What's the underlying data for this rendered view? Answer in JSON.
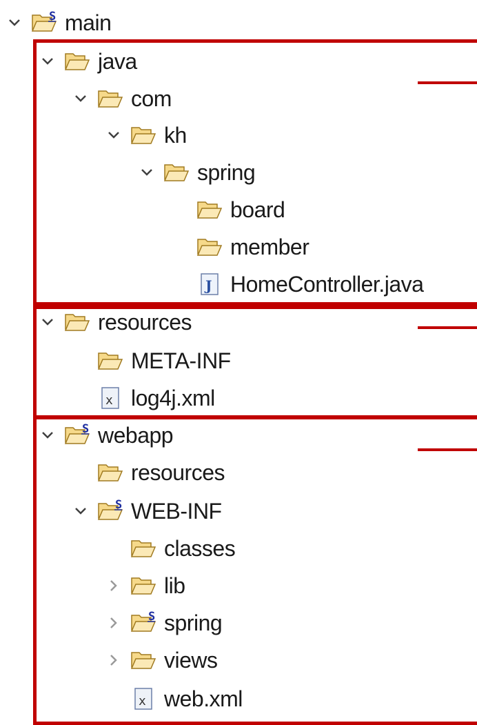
{
  "tree": [
    {
      "label": "main",
      "chevron": "down",
      "icon": "spring-folder"
    },
    {
      "label": "java",
      "chevron": "down",
      "icon": "folder"
    },
    {
      "label": "com",
      "chevron": "down",
      "icon": "folder"
    },
    {
      "label": "kh",
      "chevron": "down",
      "icon": "folder"
    },
    {
      "label": "spring",
      "chevron": "down",
      "icon": "folder"
    },
    {
      "label": "board",
      "chevron": "none",
      "icon": "folder"
    },
    {
      "label": "member",
      "chevron": "none",
      "icon": "folder"
    },
    {
      "label": "HomeController.java",
      "chevron": "none",
      "icon": "java-file"
    },
    {
      "label": "resources",
      "chevron": "down",
      "icon": "folder"
    },
    {
      "label": "META-INF",
      "chevron": "none",
      "icon": "folder"
    },
    {
      "label": "log4j.xml",
      "chevron": "none",
      "icon": "xml-file"
    },
    {
      "label": "webapp",
      "chevron": "down",
      "icon": "spring-folder"
    },
    {
      "label": "resources",
      "chevron": "none",
      "icon": "folder"
    },
    {
      "label": "WEB-INF",
      "chevron": "down",
      "icon": "spring-folder"
    },
    {
      "label": "classes",
      "chevron": "none",
      "icon": "folder"
    },
    {
      "label": "lib",
      "chevron": "right",
      "icon": "folder"
    },
    {
      "label": "spring",
      "chevron": "right",
      "icon": "spring-folder"
    },
    {
      "label": "views",
      "chevron": "right",
      "icon": "folder"
    },
    {
      "label": "web.xml",
      "chevron": "none",
      "icon": "xml-file"
    }
  ],
  "colors": {
    "highlight": "#c00000",
    "folder_fill": "#f6d98a",
    "folder_stroke": "#a07a20",
    "spring_badge": "#1f2fa0",
    "chevron": "#404040",
    "chevron_collapsed": "#9a9a9a"
  }
}
